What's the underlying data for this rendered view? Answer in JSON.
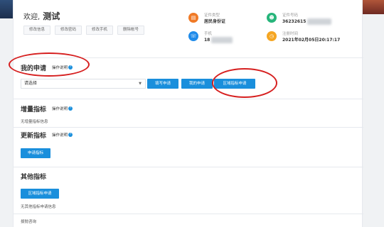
{
  "header": {
    "welcome_prefix": "欢迎,",
    "user_name": "测试",
    "account_buttons": [
      "修改信息",
      "修改密码",
      "修改手机",
      "删除帐号"
    ],
    "cert_type": {
      "label": "证件类型",
      "value": "居民身份证"
    },
    "cert_number": {
      "label": "证件号码",
      "value_visible": "36232615"
    },
    "phone": {
      "label": "手机",
      "value_visible": "18"
    },
    "register_time": {
      "label": "注册时间",
      "value": "2021年02月05日20:17:17"
    }
  },
  "my_application": {
    "title": "我的申请",
    "help_label": "操作说明",
    "select_value": "请选择",
    "buttons": [
      "填写申请",
      "我的申请",
      "区域指标申请"
    ]
  },
  "incremental_quota": {
    "title": "增量指标",
    "help_label": "操作说明",
    "empty_text": "无增量指标信息"
  },
  "renewal_quota": {
    "title": "更新指标",
    "help_label": "操作说明",
    "button_label": "申请指标"
  },
  "other_quota": {
    "title": "其他指标",
    "button_label": "区域指标申请",
    "empty_text": "无其他指标申请信息"
  },
  "bottom_section": {
    "title": "拔抛咨询"
  },
  "colors": {
    "accent_blue": "#1a8fdc",
    "annotation_red": "#d61f1f",
    "icon_orange": "#f07a26",
    "icon_green": "#27b57b",
    "icon_blue": "#1f8bea",
    "icon_amber": "#f5a623"
  }
}
